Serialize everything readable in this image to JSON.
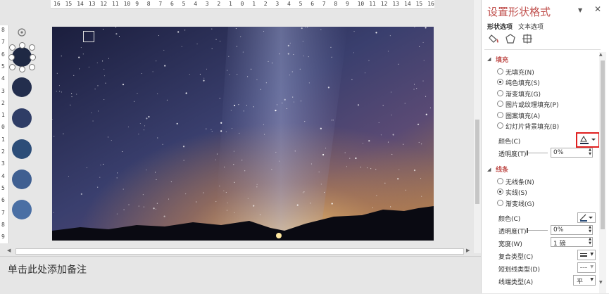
{
  "ruler": {
    "h_ticks": [
      "16",
      "15",
      "14",
      "13",
      "12",
      "11",
      "10",
      "9",
      "8",
      "7",
      "6",
      "5",
      "4",
      "3",
      "2",
      "1",
      "0",
      "1",
      "2",
      "3",
      "4",
      "5",
      "6",
      "7",
      "8",
      "9",
      "10",
      "11",
      "12",
      "13",
      "14",
      "15",
      "16"
    ],
    "v_ticks": [
      "8",
      "7",
      "6",
      "5",
      "4",
      "3",
      "2",
      "1",
      "0",
      "1",
      "2",
      "3",
      "4",
      "5",
      "6",
      "7",
      "8",
      "9"
    ]
  },
  "swatches": [
    "#1f2944",
    "#232e4d",
    "#2f3d66",
    "#2c4d78",
    "#3f5f91",
    "#4a6fa4"
  ],
  "notes": {
    "placeholder": "单击此处添加备注"
  },
  "panel": {
    "title": "设置形状格式",
    "tabs": [
      "形状选项",
      "文本选项"
    ],
    "fill": {
      "header": "填充",
      "options": [
        "无填充(N)",
        "纯色填充(S)",
        "渐变填充(G)",
        "图片或纹理填充(P)",
        "图案填充(A)",
        "幻灯片背景填充(B)"
      ],
      "selected": 1,
      "color_label": "颜色(C)",
      "transparency_label": "透明度(T)",
      "transparency_value": "0%"
    },
    "line": {
      "header": "线条",
      "options": [
        "无线条(N)",
        "实线(S)",
        "渐变线(G)"
      ],
      "selected": 1,
      "color_label": "颜色(C)",
      "transparency_label": "透明度(T)",
      "transparency_value": "0%",
      "width_label": "宽度(W)",
      "width_value": "1 磅",
      "compound_label": "复合类型(C)",
      "dash_label": "短划线类型(D)",
      "cap_label": "线端类型(A)",
      "cap_value": "平"
    }
  },
  "colors": {
    "accent": "#c0504d",
    "highlight": "#e02020"
  }
}
